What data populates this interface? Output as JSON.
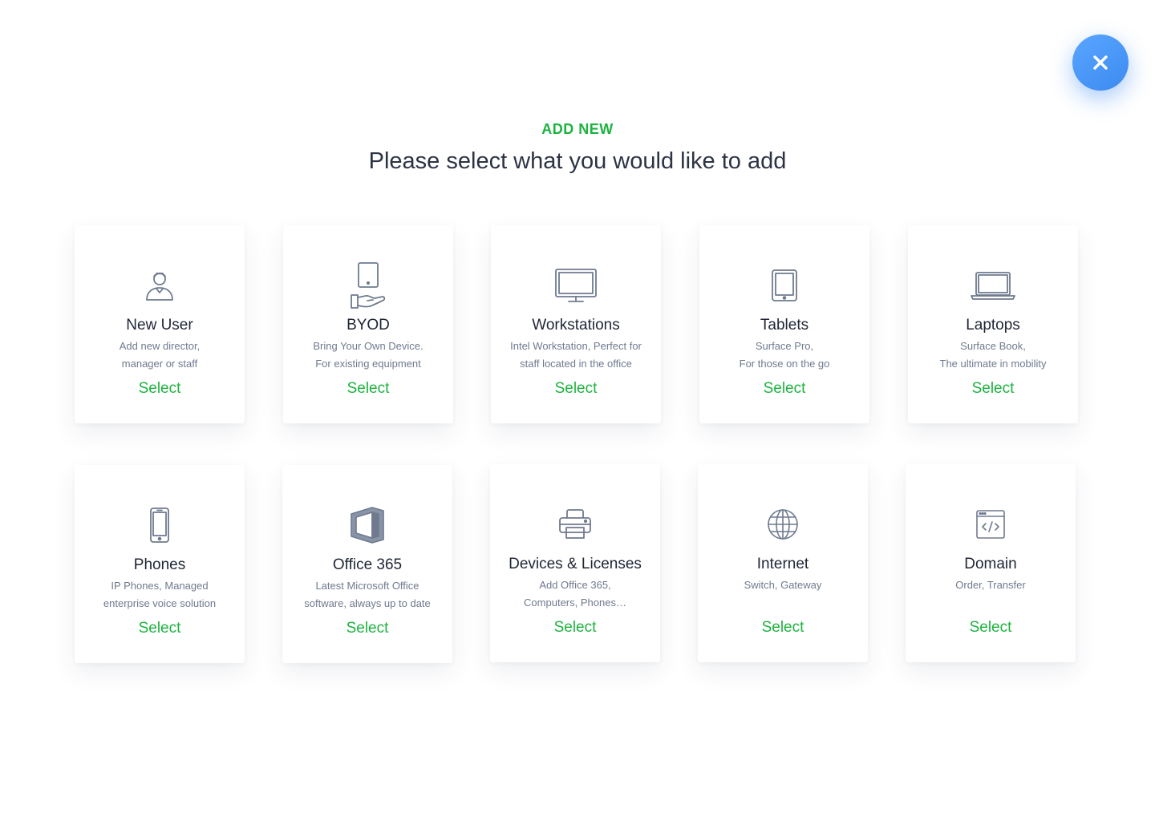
{
  "header": {
    "eyebrow": "ADD NEW",
    "title": "Please select what you would like to add"
  },
  "close_button": {
    "icon": "close-icon",
    "color": "#3b8af0"
  },
  "colors": {
    "accent": "#1db33f",
    "icon": "#6f7a8f",
    "title": "#1f2535"
  },
  "cards": [
    {
      "icon": "user-icon",
      "title": "New User",
      "desc": [
        "Add new director,",
        "manager or staff"
      ],
      "action": "Select"
    },
    {
      "icon": "byod-hand-tablet-icon",
      "title": "BYOD",
      "desc": [
        "Bring Your Own Device.",
        "For existing equipment"
      ],
      "action": "Select"
    },
    {
      "icon": "monitor-icon",
      "title": "Workstations",
      "desc": [
        "Intel Workstation, Perfect for",
        "staff located in the office"
      ],
      "action": "Select"
    },
    {
      "icon": "tablet-icon",
      "title": "Tablets",
      "desc": [
        "Surface Pro,",
        "For those on the go"
      ],
      "action": "Select"
    },
    {
      "icon": "laptop-icon",
      "title": "Laptops",
      "desc": [
        "Surface Book,",
        "The ultimate in mobility"
      ],
      "action": "Select"
    },
    {
      "icon": "phone-icon",
      "title": "Phones",
      "desc": [
        "IP Phones, Managed",
        "enterprise voice solution"
      ],
      "action": "Select"
    },
    {
      "icon": "office-icon",
      "title": "Office 365",
      "desc": [
        "Latest Microsoft Office",
        "software, always up to date"
      ],
      "action": "Select"
    },
    {
      "icon": "printer-icon",
      "title": "Devices & Licenses",
      "desc": [
        "Add Office 365,",
        "Computers, Phones…"
      ],
      "action": "Select"
    },
    {
      "icon": "globe-icon",
      "title": "Internet",
      "desc": [
        "Switch, Gateway",
        ""
      ],
      "action": "Select"
    },
    {
      "icon": "code-window-icon",
      "title": "Domain",
      "desc": [
        "Order, Transfer",
        ""
      ],
      "action": "Select"
    }
  ]
}
